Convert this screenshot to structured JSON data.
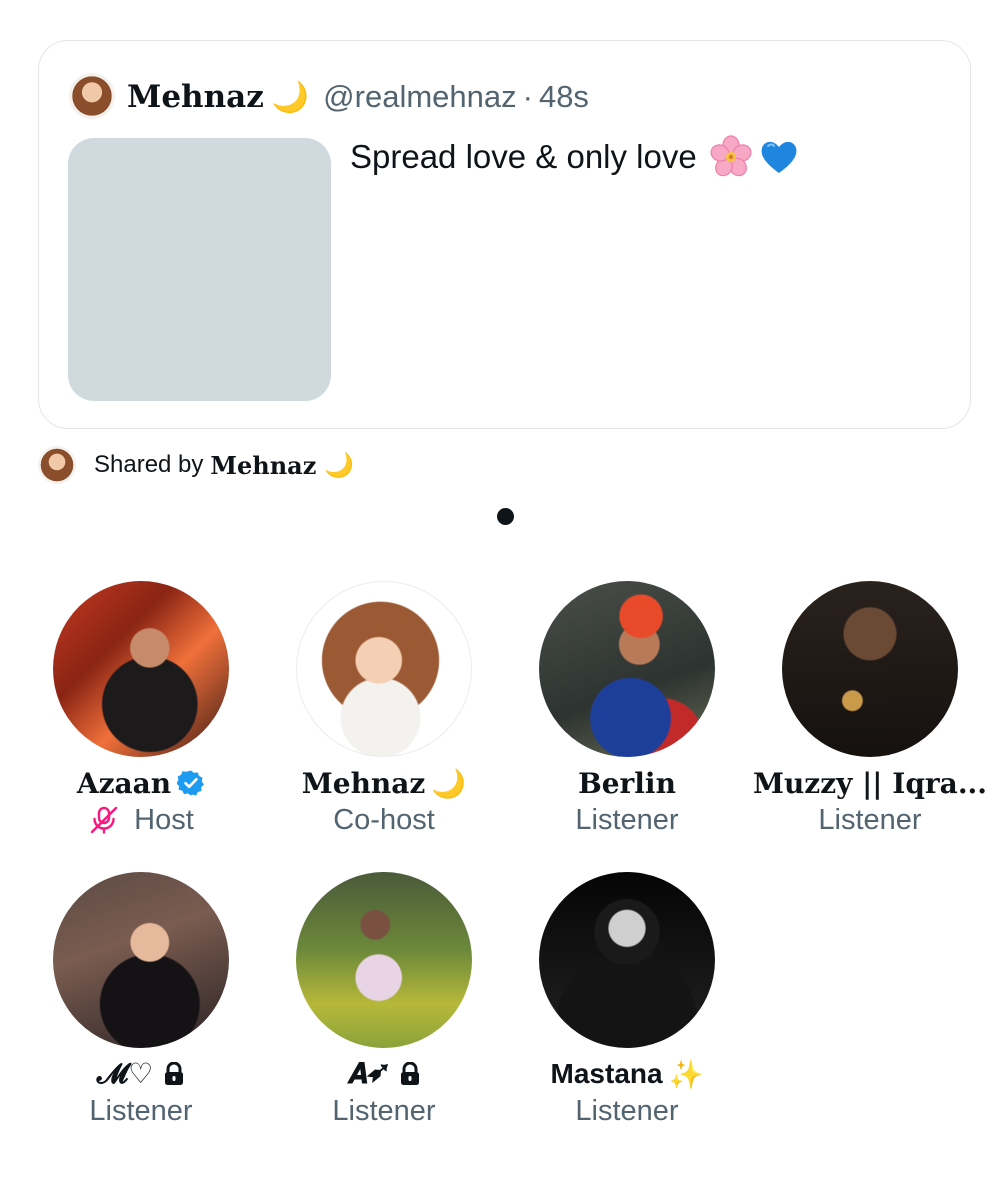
{
  "shared_post": {
    "author_name": "Mehnaz",
    "author_emoji": "🌙",
    "handle": "@realmehnaz",
    "separator": "·",
    "timestamp": "48s",
    "text": "Spread love & only love",
    "text_emojis": [
      "🌸",
      "💙"
    ]
  },
  "shared_by": {
    "prefix": "Shared by",
    "name": "Mehnaz",
    "emoji": "🌙"
  },
  "pagination": {
    "active_index": 0,
    "count": 1
  },
  "participants": [
    {
      "name": "Azaan",
      "role": "Host",
      "verified": true,
      "muted": true,
      "avatar": "man-in-black-sweater-red-lights"
    },
    {
      "name": "Mehnaz",
      "emoji": "🌙",
      "role": "Co-host",
      "avatar": "illustrated-curly-hair-woman"
    },
    {
      "name": "Berlin",
      "role": "Listener",
      "avatar": "cricketer-red-cap"
    },
    {
      "name": "Muzzy || Iqra...",
      "role": "Listener",
      "avatar": "bearded-man-muzzy-poster"
    },
    {
      "name": "𝓜♡",
      "role": "Listener",
      "locked": true,
      "avatar": "woman-in-black-hoodie"
    },
    {
      "name": "𝑨➶",
      "role": "Listener",
      "locked": true,
      "avatar": "woman-in-floral-dress-field"
    },
    {
      "name": "Mastana",
      "emoji": "✨",
      "role": "Listener",
      "avatar": "man-in-black-hood-monochrome"
    }
  ],
  "colors": {
    "text_primary": "#0f1419",
    "text_secondary": "#536471",
    "verified_blue": "#1d9bf0",
    "muted_pink": "#f91880",
    "placeholder": "#cfd9de",
    "card_border": "#e3e6e9"
  }
}
